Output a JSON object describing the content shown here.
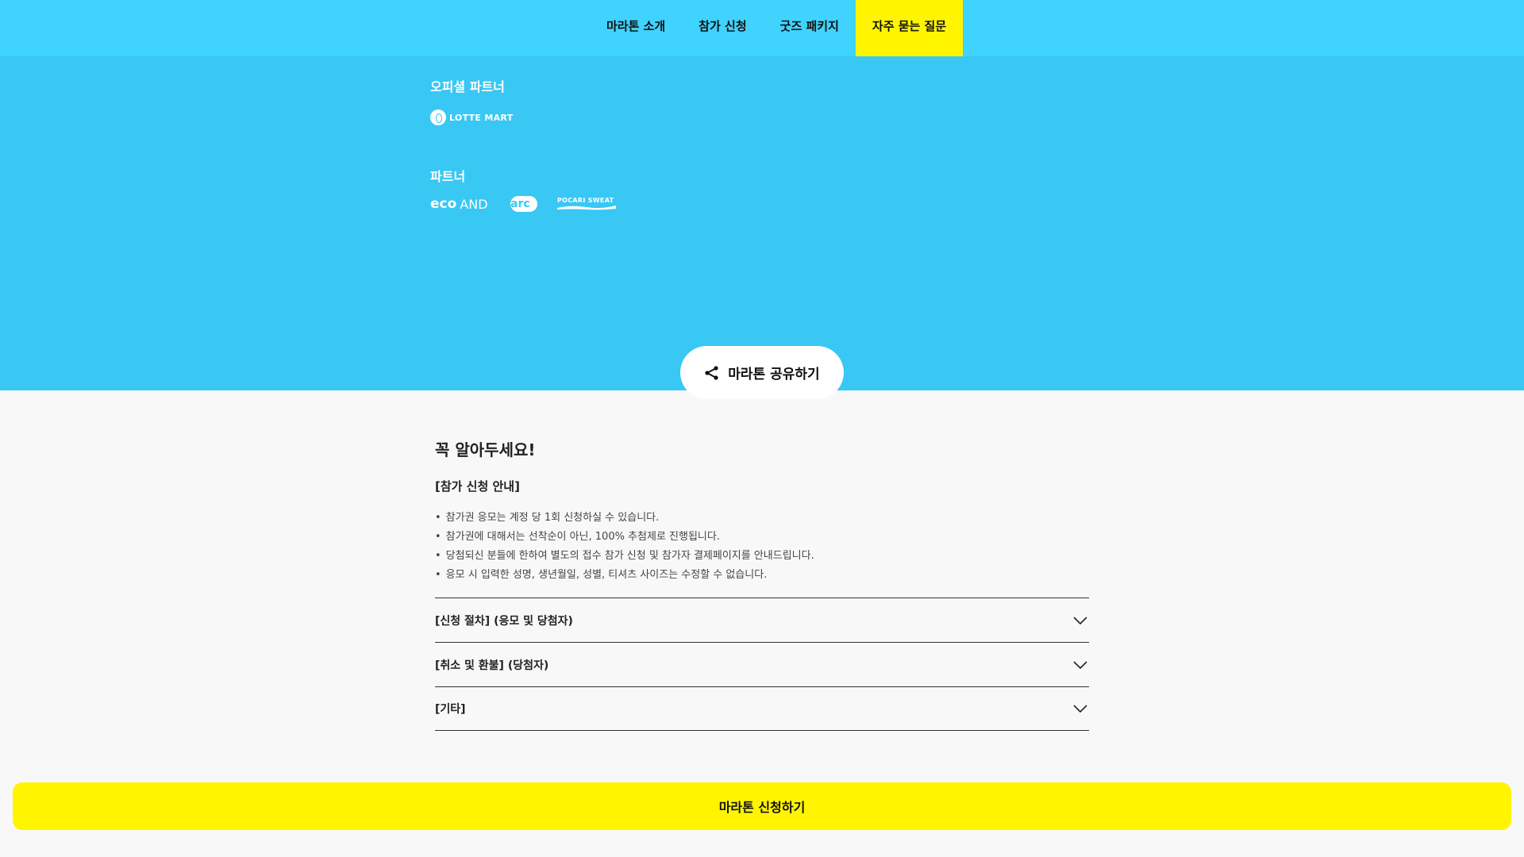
{
  "nav": {
    "items": [
      {
        "label": "마라톤 소개",
        "active": false
      },
      {
        "label": "참가 신청",
        "active": false
      },
      {
        "label": "굿즈 패키지",
        "active": false
      },
      {
        "label": "자주 묻는 질문",
        "active": true
      }
    ]
  },
  "partners": {
    "official_heading": "오피셜 파트너",
    "official_logos": [
      {
        "name": "lotte-mart-logo",
        "text": "LOTTE MART"
      }
    ],
    "partner_heading": "파트너",
    "partner_logos": [
      {
        "name": "ecoand-logo",
        "text_bold": "eco",
        "text_light": "AND"
      },
      {
        "name": "arc-logo",
        "text": "arc"
      },
      {
        "name": "pocari-sweat-logo",
        "text": "POCARI SWEAT"
      }
    ]
  },
  "share": {
    "label": "마라톤 공유하기",
    "icon": "share-icon"
  },
  "notice": {
    "title": "꼭 알아두세요!",
    "section_title": "[참가 신청 안내]",
    "bullets": [
      "참가권 응모는 계정 당 1회 신청하실 수 있습니다.",
      "참가권에 대해서는 선착순이 아닌, 100% 추첨제로 진행됩니다.",
      "당첨되신 분들에 한하여 별도의 접수 참가 신청 및 참가자 결제페이지를 안내드립니다.",
      "응모 시 입력한 성명, 생년월일, 성별, 티셔츠 사이즈는 수정할 수 없습니다."
    ],
    "accordion": [
      {
        "label": "[신청 절차] (응모 및 당첨자)",
        "icon": "chevron-down-icon"
      },
      {
        "label": "[취소 및 환불] (당첨자)",
        "icon": "chevron-down-icon"
      },
      {
        "label": "[기타]",
        "icon": "chevron-down-icon"
      }
    ]
  },
  "apply": {
    "label": "마라톤 신청하기"
  },
  "colors": {
    "nav_bg": "#3fd3fd",
    "partner_bg": "#39c7f4",
    "accent_yellow": "#fff500",
    "page_bg": "#f8f8f8"
  }
}
